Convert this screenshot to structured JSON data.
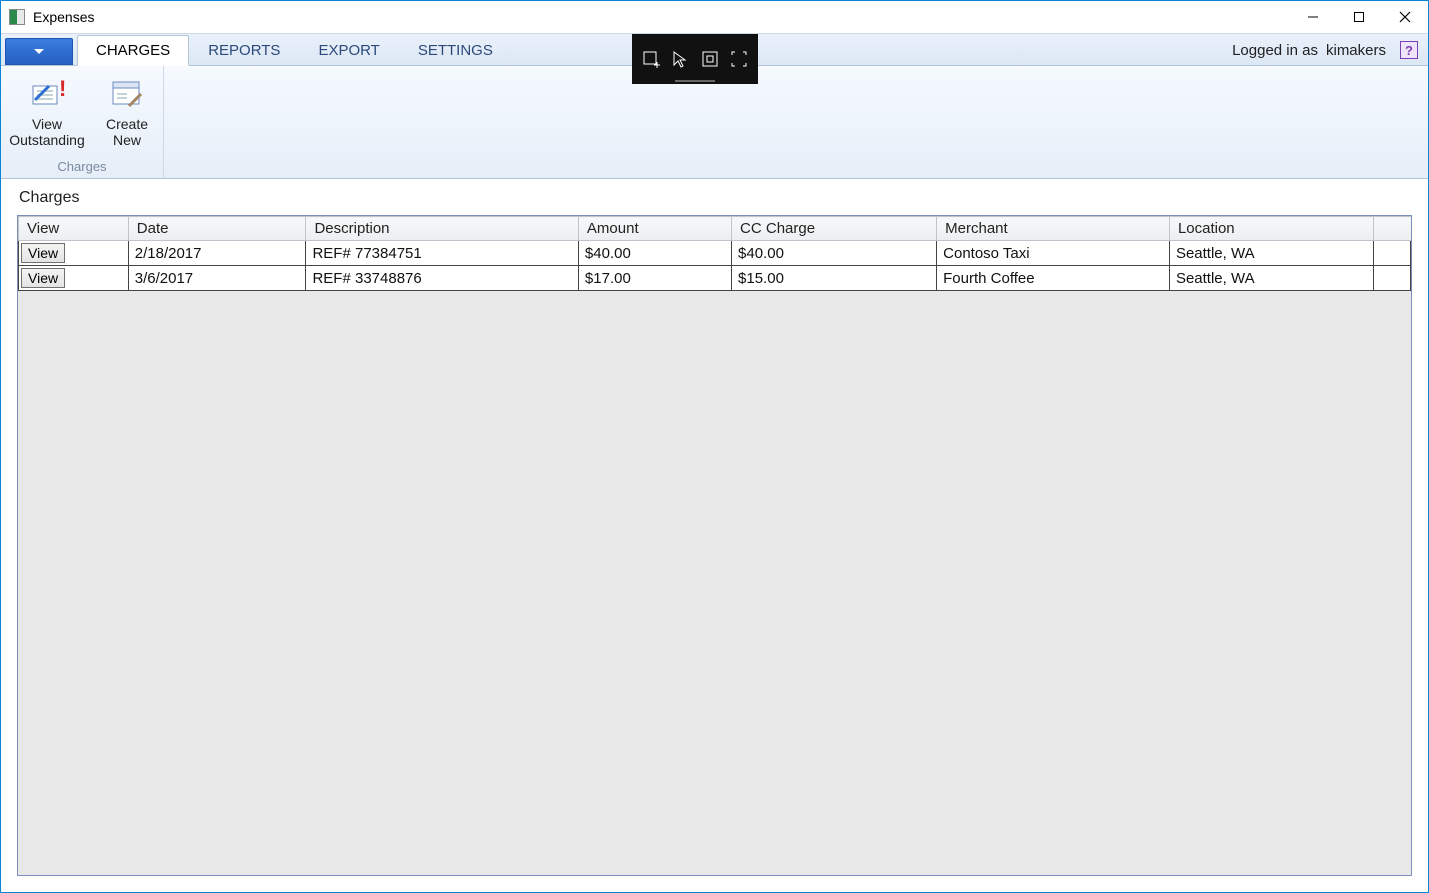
{
  "window": {
    "title": "Expenses"
  },
  "ribbon": {
    "tabs": [
      "CHARGES",
      "REPORTS",
      "EXPORT",
      "SETTINGS"
    ],
    "active_tab_index": 0,
    "logged_in_label": "Logged in as",
    "username": "kimakers",
    "charges_group": {
      "label": "Charges",
      "view_outstanding_line1": "View",
      "view_outstanding_line2": "Outstanding",
      "create_new_line1": "Create",
      "create_new_line2": "New"
    }
  },
  "content": {
    "header": "Charges",
    "columns": [
      "View",
      "Date",
      "Description",
      "Amount",
      "CC Charge",
      "Merchant",
      "Location"
    ],
    "view_button_label": "View",
    "rows": [
      {
        "date": "2/18/2017",
        "description": "REF# 77384751",
        "amount": "$40.00",
        "cc_charge": "$40.00",
        "merchant": "Contoso Taxi",
        "location": "Seattle, WA"
      },
      {
        "date": "3/6/2017",
        "description": "REF# 33748876",
        "amount": "$17.00",
        "cc_charge": "$15.00",
        "merchant": "Fourth Coffee",
        "location": "Seattle, WA"
      }
    ]
  }
}
